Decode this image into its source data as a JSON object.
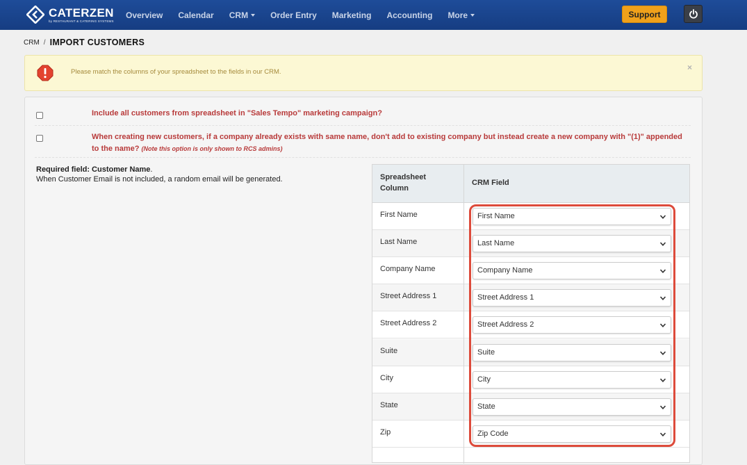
{
  "brand": {
    "title": "CATERZEN",
    "subtitle": "by RESTAURANT & CATERING SYSTEMS"
  },
  "nav": {
    "items": [
      {
        "label": "Overview",
        "dropdown": false
      },
      {
        "label": "Calendar",
        "dropdown": false
      },
      {
        "label": "CRM",
        "dropdown": true
      },
      {
        "label": "Order Entry",
        "dropdown": false
      },
      {
        "label": "Marketing",
        "dropdown": false
      },
      {
        "label": "Accounting",
        "dropdown": false
      },
      {
        "label": "More",
        "dropdown": true
      }
    ],
    "support_label": "Support",
    "power_icon": "power-icon"
  },
  "breadcrumb": {
    "parent": "CRM",
    "separator": "/",
    "current": "IMPORT CUSTOMERS"
  },
  "alert": {
    "icon": "warning-icon",
    "message": "Please match the columns of your spreadsheet to the fields in our CRM.",
    "close": "×"
  },
  "options": {
    "include_campaign": "Include all customers from spreadsheet in \"Sales Tempo\" marketing campaign?",
    "new_company": "When creating new customers, if a company already exists with same name, don't add to existing company but instead create a new company with \"(1)\" appended to the name?",
    "new_company_note": "(Note this option is only shown to RCS admins)"
  },
  "requirements": {
    "required_label": "Required field: Customer Name",
    "required_suffix": ".",
    "email_note": "When Customer Email is not included, a random email will be generated."
  },
  "table": {
    "col_header": "Spreadsheet Column",
    "field_header": "CRM Field",
    "rows": [
      {
        "column": "First Name",
        "field": "First Name"
      },
      {
        "column": "Last Name",
        "field": "Last Name"
      },
      {
        "column": "Company Name",
        "field": "Company Name"
      },
      {
        "column": "Street Address 1",
        "field": "Street Address 1"
      },
      {
        "column": "Street Address 2",
        "field": "Street Address 2"
      },
      {
        "column": "Suite",
        "field": "Suite"
      },
      {
        "column": "City",
        "field": "City"
      },
      {
        "column": "State",
        "field": "State"
      },
      {
        "column": "Zip",
        "field": "Zip Code"
      }
    ]
  },
  "colors": {
    "navbar": "#1e4c99",
    "support": "#f0a11b",
    "alert_bg": "#fcf8d4",
    "option_text": "#b83a3a",
    "highlight": "#dd4b3b"
  }
}
